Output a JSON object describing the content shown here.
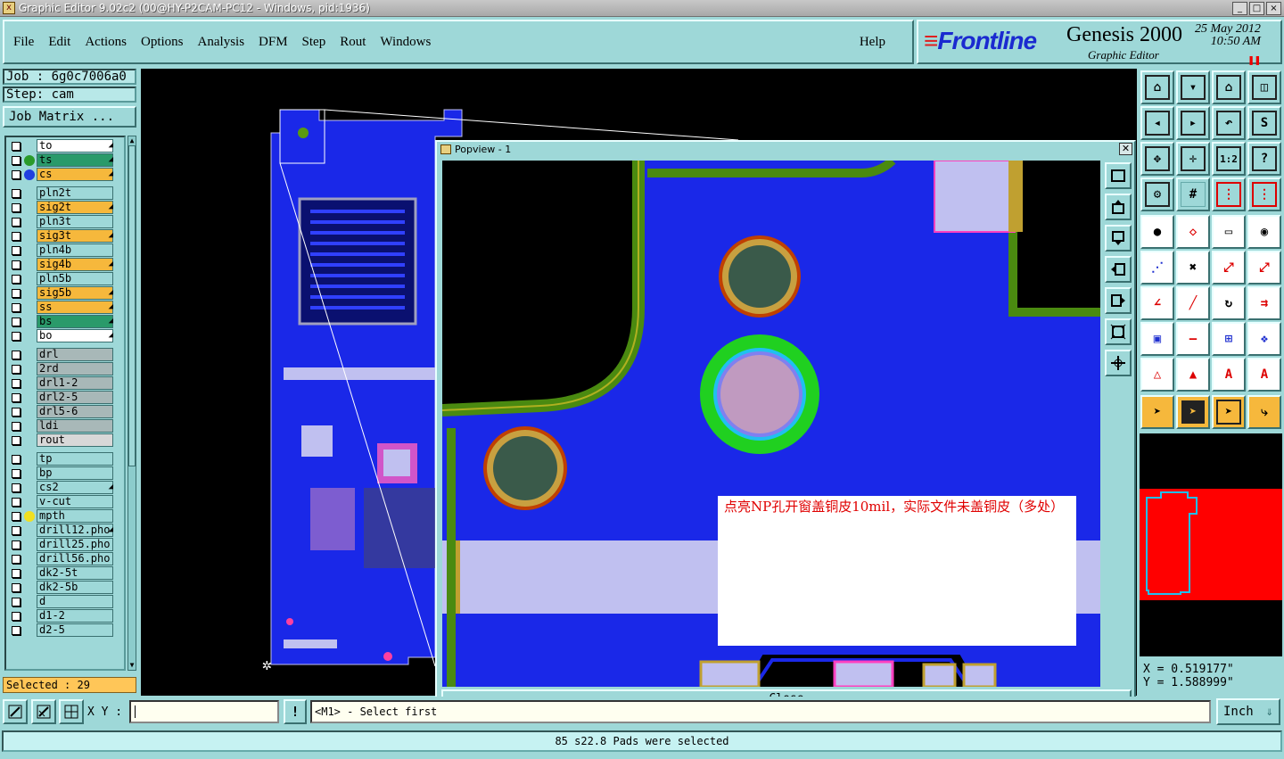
{
  "window": {
    "title": "Graphic Editor 9.02c2 (00@HY-P2CAM-PC12 - Windows, pid:1936)"
  },
  "menu": [
    "File",
    "Edit",
    "Actions",
    "Options",
    "Analysis",
    "DFM",
    "Step",
    "Rout",
    "Windows"
  ],
  "help_label": "Help",
  "brand": {
    "logo": "Frontline",
    "product": "Genesis 2000",
    "subtitle": "Graphic Editor",
    "date": "25 May 2012",
    "time": "10:50 AM"
  },
  "job": {
    "job_label": "Job : 6g0c7006a0",
    "step_label": "Step: cam",
    "matrix_button": "Job Matrix ..."
  },
  "layers": [
    {
      "name": "to",
      "color": "#ffffff",
      "dot": "",
      "arrow": true
    },
    {
      "name": "ts",
      "color": "#2a9a6a",
      "dot": "#2a9a2a",
      "arrow": true
    },
    {
      "name": "cs",
      "color": "#f6b83c",
      "dot": "#2040e0",
      "arrow": true
    },
    {
      "name": "pln2t",
      "color": "#9ed8d8",
      "dot": "",
      "arrow": false
    },
    {
      "name": "sig2t",
      "color": "#f6b83c",
      "dot": "",
      "arrow": true
    },
    {
      "name": "pln3t",
      "color": "#9ed8d8",
      "dot": "",
      "arrow": false
    },
    {
      "name": "sig3t",
      "color": "#f6b83c",
      "dot": "",
      "arrow": true
    },
    {
      "name": "pln4b",
      "color": "#9ed8d8",
      "dot": "",
      "arrow": false
    },
    {
      "name": "sig4b",
      "color": "#f6b83c",
      "dot": "",
      "arrow": true
    },
    {
      "name": "pln5b",
      "color": "#9ed8d8",
      "dot": "",
      "arrow": false
    },
    {
      "name": "sig5b",
      "color": "#f6b83c",
      "dot": "",
      "arrow": true
    },
    {
      "name": "ss",
      "color": "#f6b83c",
      "dot": "",
      "arrow": true
    },
    {
      "name": "bs",
      "color": "#2a9a6a",
      "dot": "",
      "arrow": true
    },
    {
      "name": "bo",
      "color": "#ffffff",
      "dot": "",
      "arrow": true
    },
    {
      "name": "drl",
      "color": "#a8b8b8",
      "dot": "",
      "arrow": false
    },
    {
      "name": "2rd",
      "color": "#a8b8b8",
      "dot": "",
      "arrow": false
    },
    {
      "name": "drl1-2",
      "color": "#a8b8b8",
      "dot": "",
      "arrow": false
    },
    {
      "name": "drl2-5",
      "color": "#a8b8b8",
      "dot": "",
      "arrow": false
    },
    {
      "name": "drl5-6",
      "color": "#a8b8b8",
      "dot": "",
      "arrow": false
    },
    {
      "name": "ldi",
      "color": "#a8b8b8",
      "dot": "",
      "arrow": false
    },
    {
      "name": "rout",
      "color": "#d8d8d8",
      "dot": "",
      "arrow": false
    },
    {
      "name": "tp",
      "color": "#9ed8d8",
      "dot": "",
      "arrow": false
    },
    {
      "name": "bp",
      "color": "#9ed8d8",
      "dot": "",
      "arrow": false
    },
    {
      "name": "cs2",
      "color": "#9ed8d8",
      "dot": "",
      "arrow": true
    },
    {
      "name": "v-cut",
      "color": "#9ed8d8",
      "dot": "",
      "arrow": false
    },
    {
      "name": "mpth",
      "color": "#9ed8d8",
      "dot": "#f0e020",
      "arrow": false
    },
    {
      "name": "drill12.pho",
      "color": "#9ed8d8",
      "dot": "",
      "arrow": true
    },
    {
      "name": "drill25.pho",
      "color": "#9ed8d8",
      "dot": "",
      "arrow": false
    },
    {
      "name": "drill56.pho",
      "color": "#9ed8d8",
      "dot": "",
      "arrow": false
    },
    {
      "name": "dk2-5t",
      "color": "#9ed8d8",
      "dot": "",
      "arrow": false
    },
    {
      "name": "dk2-5b",
      "color": "#9ed8d8",
      "dot": "",
      "arrow": false
    },
    {
      "name": "d",
      "color": "#9ed8d8",
      "dot": "",
      "arrow": false
    },
    {
      "name": "d1-2",
      "color": "#9ed8d8",
      "dot": "",
      "arrow": false
    },
    {
      "name": "d2-5",
      "color": "#9ed8d8",
      "dot": "",
      "arrow": false
    }
  ],
  "selected_label": "Selected : 29",
  "popup": {
    "title": "Popview - 1",
    "close_label": "Close",
    "note": "点亮NP孔开窗盖铜皮10mil，实际文件未盖铜皮（多处）"
  },
  "coords": {
    "x": "X = 0.519177\"",
    "y": "Y = 1.588999\""
  },
  "bottom": {
    "xy_label": "X Y :",
    "xy_value": "",
    "message": "<M1> - Select first",
    "unit": "Inch"
  },
  "status": "85 s22.8 Pads were selected",
  "colors": {
    "panel": "#9ed8d8",
    "board": "#1a28e8",
    "copper_green": "#5a9a10",
    "soldermask": "#c0c0f0"
  }
}
